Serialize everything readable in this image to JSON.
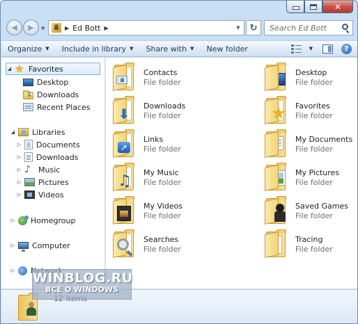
{
  "window": {
    "buttons": {
      "minimize_icon": "minimize-icon",
      "maximize_icon": "maximize-icon",
      "close_label": "✕"
    }
  },
  "address_bar": {
    "breadcrumb": [
      "Ed Bott"
    ],
    "search_placeholder": "Search Ed Bott"
  },
  "toolbar": {
    "organize": "Organize",
    "include_in_library": "Include in library",
    "share_with": "Share with",
    "new_folder": "New folder",
    "help": "?"
  },
  "nav_pane": {
    "favorites": {
      "label": "Favorites",
      "items": [
        "Desktop",
        "Downloads",
        "Recent Places"
      ]
    },
    "libraries": {
      "label": "Libraries",
      "items": [
        "Documents",
        "Downloads",
        "Music",
        "Pictures",
        "Videos"
      ]
    },
    "homegroup": "Homegroup",
    "computer": "Computer",
    "network": "Network"
  },
  "content": {
    "type_label": "File folder",
    "items": [
      {
        "name": "Contacts",
        "icon": "contacts-folder-icon"
      },
      {
        "name": "Desktop",
        "icon": "desktop-folder-icon"
      },
      {
        "name": "Downloads",
        "icon": "downloads-folder-icon"
      },
      {
        "name": "Favorites",
        "icon": "favorites-folder-icon"
      },
      {
        "name": "Links",
        "icon": "links-folder-icon"
      },
      {
        "name": "My Documents",
        "icon": "documents-folder-icon"
      },
      {
        "name": "My Music",
        "icon": "music-folder-icon"
      },
      {
        "name": "My Pictures",
        "icon": "pictures-folder-icon"
      },
      {
        "name": "My Videos",
        "icon": "videos-folder-icon"
      },
      {
        "name": "Saved Games",
        "icon": "saved-games-folder-icon"
      },
      {
        "name": "Searches",
        "icon": "searches-folder-icon"
      },
      {
        "name": "Tracing",
        "icon": "tracing-folder-icon"
      }
    ]
  },
  "details": {
    "count": "12 items"
  },
  "watermark": {
    "line1": "WINBLOG.RU",
    "line2": "ВСЁ О WINDOWS"
  },
  "colors": {
    "selection_border": "#84acdd",
    "toolbar_text": "#1e395b",
    "secondary_text": "#6d6d6d"
  }
}
